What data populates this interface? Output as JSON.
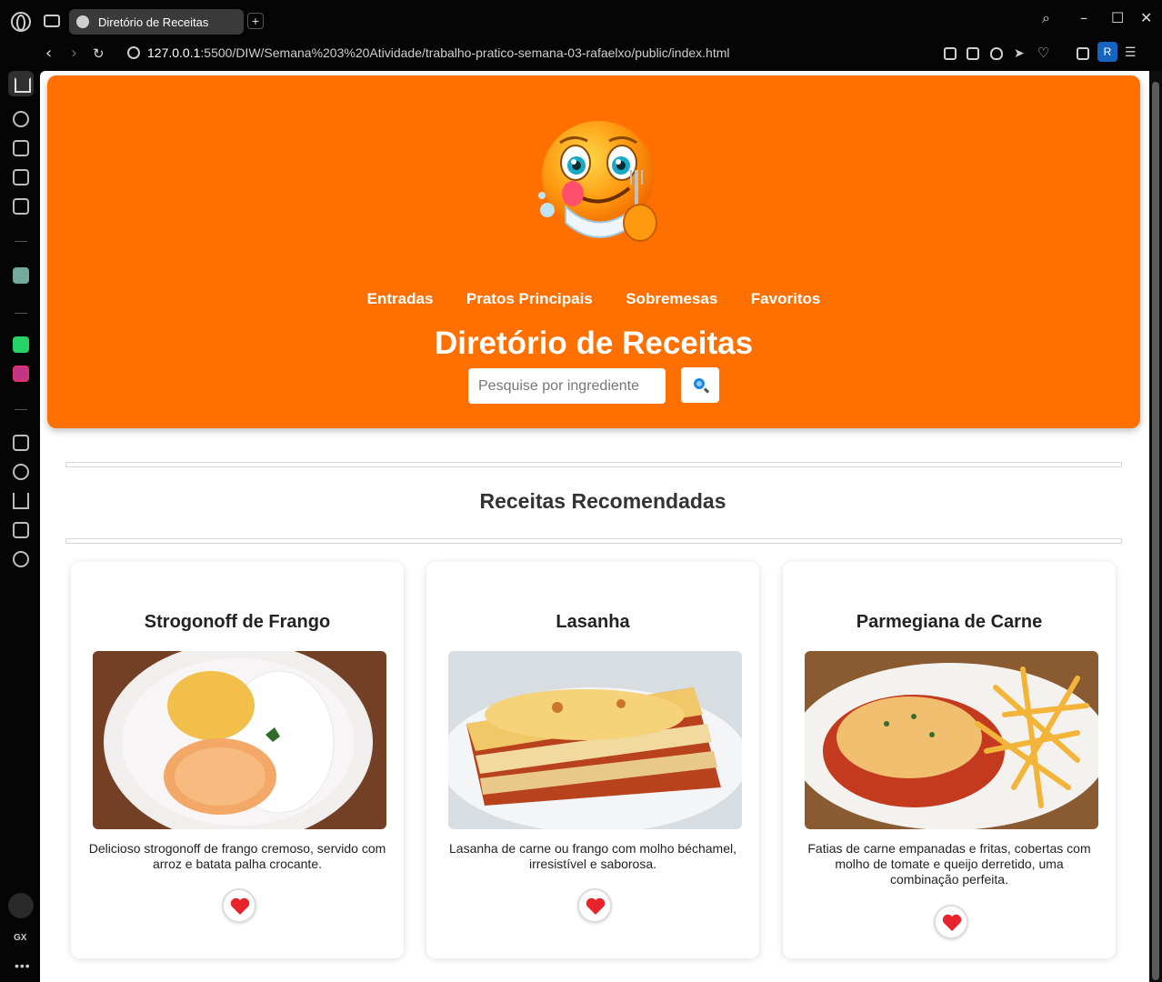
{
  "browser": {
    "tab_title": "Diretório de Receitas",
    "new_tab": "+",
    "url_host": "127.0.0.1",
    "url_rest": ":5500/DIW/Semana%203%20Atividade/trabalho-pratico-semana-03-rafaelxo/public/index.html",
    "profile_initial": "R",
    "sidebar_gx": "GX",
    "sidebar_more": "•••"
  },
  "header": {
    "menu": [
      "Entradas",
      "Pratos Principais",
      "Sobremesas",
      "Favoritos"
    ],
    "title": "Diretório de Receitas",
    "search_placeholder": "Pesquise por ingrediente"
  },
  "section": {
    "title": "Receitas Recomendadas"
  },
  "recipes": [
    {
      "name": "Strogonoff de Frango",
      "description": "Delicioso strogonoff de frango cremoso, servido com arroz e batata palha crocante."
    },
    {
      "name": "Lasanha",
      "description": "Lasanha de carne ou frango com molho béchamel, irresistível e saborosa."
    },
    {
      "name": "Parmegiana de Carne",
      "description": "Fatias de carne empanadas e fritas, cobertas com molho de tomate e queijo derretido, uma combinação perfeita."
    }
  ],
  "colors": {
    "header_bg": "#ff7000",
    "heart": "#e8232b",
    "search_icon": "#1e88e5"
  },
  "icons": {
    "favorite": "heart-icon",
    "search": "magnifier-icon"
  }
}
